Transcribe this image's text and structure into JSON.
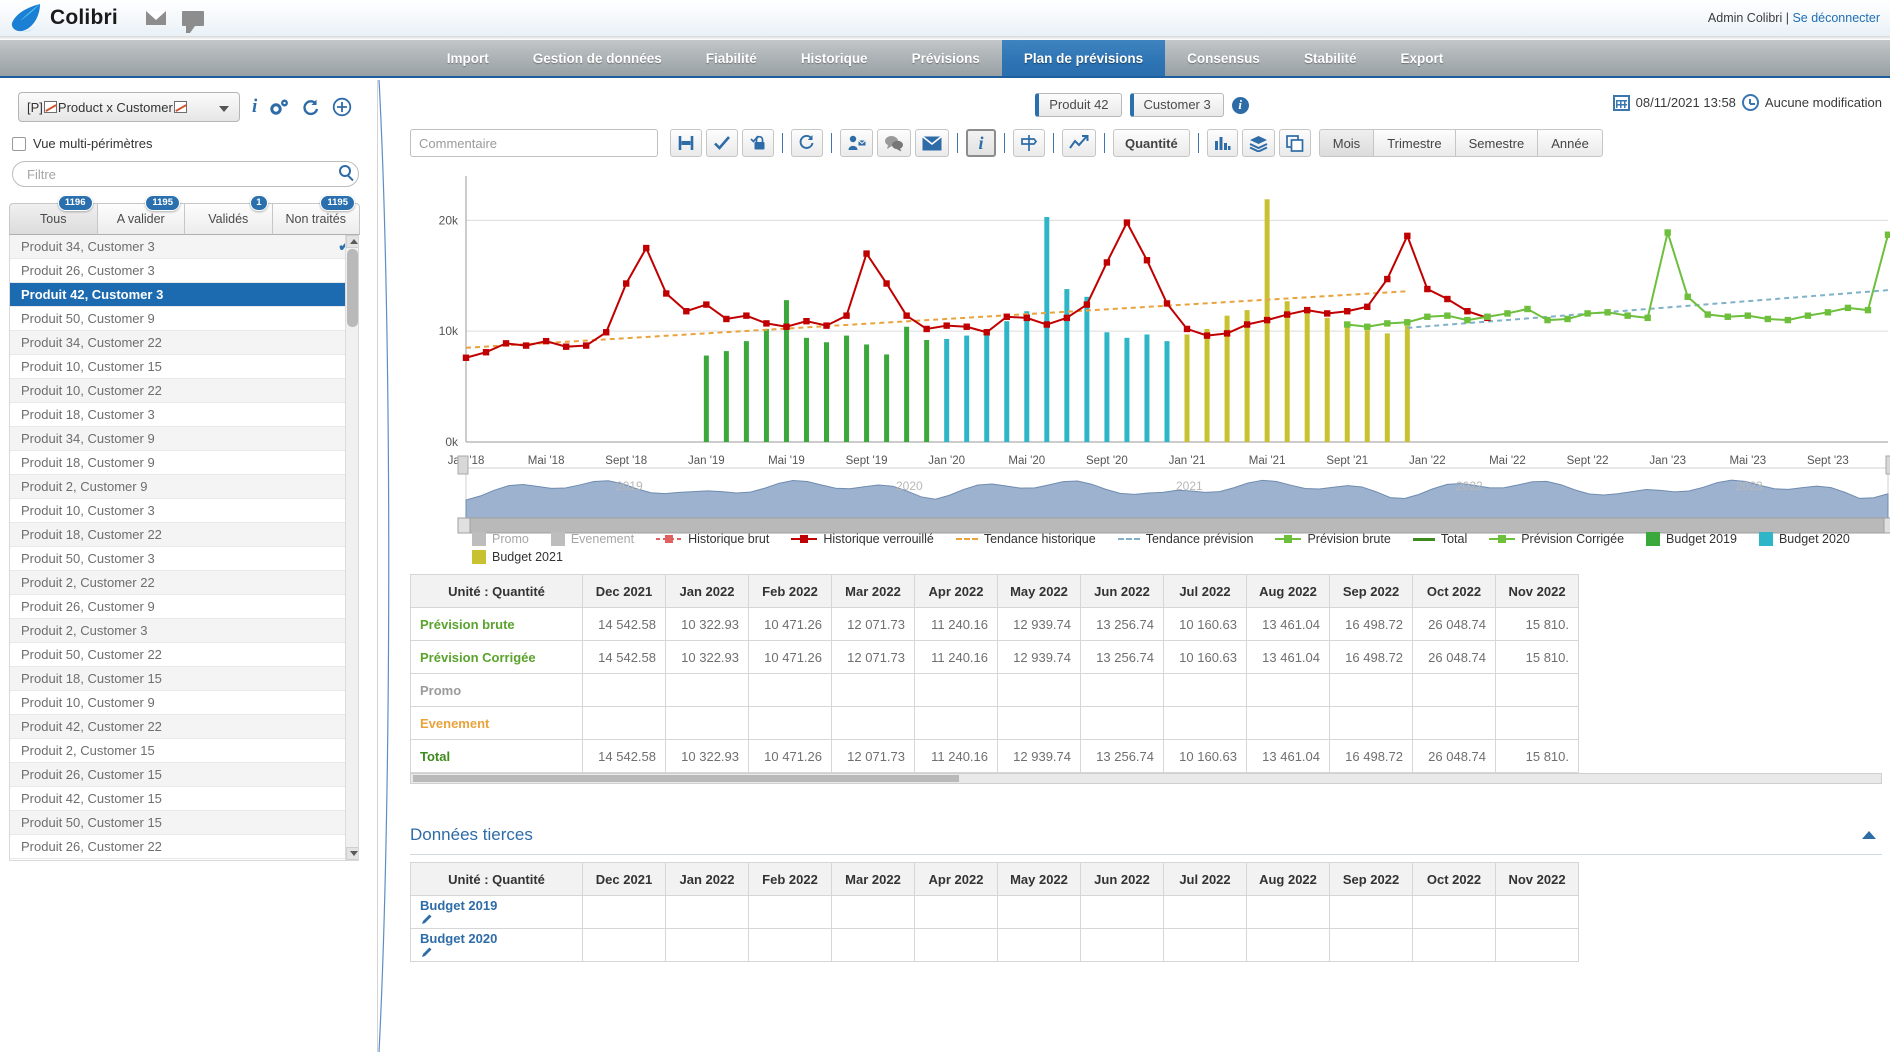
{
  "topbar": {
    "brand": "Colibri",
    "mail_icon": "envelope-icon",
    "chat_icon": "chat-bubble-icon",
    "user": "Admin Colibri | ",
    "logout": "Se déconnecter"
  },
  "nav": {
    "items": [
      {
        "label": "Import",
        "active": false
      },
      {
        "label": "Gestion de données",
        "active": false
      },
      {
        "label": "Fiabilité",
        "active": false
      },
      {
        "label": "Historique",
        "active": false
      },
      {
        "label": "Prévisions",
        "active": false
      },
      {
        "label": "Plan de prévisions",
        "active": true
      },
      {
        "label": "Consensus",
        "active": false
      },
      {
        "label": "Stabilité",
        "active": false
      },
      {
        "label": "Export",
        "active": false
      }
    ]
  },
  "sidebar": {
    "perimeter_prefix": "[P] ",
    "perimeter_label": "Product x Customer",
    "tools": [
      {
        "name": "info-icon",
        "glyph": "i"
      },
      {
        "name": "settings-gear-icon",
        "glyph": "⚙"
      },
      {
        "name": "refresh-icon",
        "glyph": "↺"
      },
      {
        "name": "add-circle-icon",
        "glyph": "⊕"
      }
    ],
    "multi_perimeter_label": "Vue multi-périmètres",
    "filter_placeholder": "Filtre",
    "tabs": [
      {
        "label": "Tous",
        "badge": "1196",
        "active": true
      },
      {
        "label": "A valider",
        "badge": "1195",
        "active": false
      },
      {
        "label": "Validés",
        "badge": "1",
        "active": false
      },
      {
        "label": "Non traités",
        "badge": "1195",
        "active": false
      }
    ],
    "items": [
      {
        "label": "Produit 34, Customer 3",
        "selected": false,
        "checked": true
      },
      {
        "label": "Produit 26, Customer 3",
        "selected": false,
        "checked": false
      },
      {
        "label": "Produit 42, Customer 3",
        "selected": true,
        "checked": false
      },
      {
        "label": "Produit 50, Customer 9",
        "selected": false,
        "checked": false
      },
      {
        "label": "Produit 34, Customer 22",
        "selected": false,
        "checked": false
      },
      {
        "label": "Produit 10, Customer 15",
        "selected": false,
        "checked": false
      },
      {
        "label": "Produit 10, Customer 22",
        "selected": false,
        "checked": false
      },
      {
        "label": "Produit 18, Customer 3",
        "selected": false,
        "checked": false
      },
      {
        "label": "Produit 34, Customer 9",
        "selected": false,
        "checked": false
      },
      {
        "label": "Produit 18, Customer 9",
        "selected": false,
        "checked": false
      },
      {
        "label": "Produit 2, Customer 9",
        "selected": false,
        "checked": false
      },
      {
        "label": "Produit 10, Customer 3",
        "selected": false,
        "checked": false
      },
      {
        "label": "Produit 18, Customer 22",
        "selected": false,
        "checked": false
      },
      {
        "label": "Produit 50, Customer 3",
        "selected": false,
        "checked": false
      },
      {
        "label": "Produit 2, Customer 22",
        "selected": false,
        "checked": false
      },
      {
        "label": "Produit 26, Customer 9",
        "selected": false,
        "checked": false
      },
      {
        "label": "Produit 2, Customer 3",
        "selected": false,
        "checked": false
      },
      {
        "label": "Produit 50, Customer 22",
        "selected": false,
        "checked": false
      },
      {
        "label": "Produit 18, Customer 15",
        "selected": false,
        "checked": false
      },
      {
        "label": "Produit 10, Customer 9",
        "selected": false,
        "checked": false
      },
      {
        "label": "Produit 42, Customer 22",
        "selected": false,
        "checked": false
      },
      {
        "label": "Produit 2, Customer 15",
        "selected": false,
        "checked": false
      },
      {
        "label": "Produit 26, Customer 15",
        "selected": false,
        "checked": false
      },
      {
        "label": "Produit 42, Customer 15",
        "selected": false,
        "checked": false
      },
      {
        "label": "Produit 50, Customer 15",
        "selected": false,
        "checked": false
      },
      {
        "label": "Produit 26, Customer 22",
        "selected": false,
        "checked": false
      }
    ]
  },
  "header": {
    "chips": [
      "Produit 42",
      "Customer 3"
    ],
    "info_icon": "info-circle-icon",
    "calendar_icon": "calendar-icon",
    "datetime": "08/11/2021 13:58",
    "clock_icon": "clock-icon",
    "modification_status": "Aucune modification"
  },
  "toolbar": {
    "comment_placeholder": "Commentaire",
    "buttons": [
      {
        "name": "save-button",
        "glyph": "H",
        "selected": false
      },
      {
        "name": "validate-check-button",
        "glyph": "✔",
        "selected": false
      },
      {
        "name": "lock-validate-button",
        "glyph": "🔒",
        "selected": false
      },
      {
        "name": "refresh-recalc-button",
        "glyph": "↻",
        "selected": false
      },
      {
        "name": "assign-user-button",
        "glyph": "👤",
        "selected": false
      },
      {
        "name": "comments-button",
        "glyph": "💬",
        "selected": false
      },
      {
        "name": "email-button",
        "glyph": "✉",
        "selected": false
      },
      {
        "name": "info-button",
        "glyph": "i",
        "selected": true
      },
      {
        "name": "signpost-button",
        "glyph": "⌯",
        "selected": false
      },
      {
        "name": "trend-button",
        "glyph": "📈",
        "selected": false
      }
    ],
    "unit_label": "Quantité",
    "view_buttons": [
      {
        "name": "bar-chart-button",
        "glyph": "▮"
      },
      {
        "name": "layers-button",
        "glyph": "≋"
      },
      {
        "name": "copy-button",
        "glyph": "❐"
      }
    ],
    "granularity": [
      {
        "label": "Mois",
        "active": true
      },
      {
        "label": "Trimestre",
        "active": false
      },
      {
        "label": "Semestre",
        "active": false
      },
      {
        "label": "Année",
        "active": false
      }
    ]
  },
  "chart_data": {
    "type": "line",
    "title": "",
    "xlabel": "",
    "ylabel": "",
    "ylim": [
      0,
      24000
    ],
    "yticks": [
      0,
      10000,
      20000
    ],
    "ytick_labels": [
      "0k",
      "10k",
      "20k"
    ],
    "grid": true,
    "legend_position": "bottom",
    "xtick_labels": [
      "Jan '18",
      "Mai '18",
      "Sept '18",
      "Jan '19",
      "Mai '19",
      "Sept '19",
      "Jan '20",
      "Mai '20",
      "Sept '20",
      "Jan '21",
      "Mai '21",
      "Sept '21",
      "Jan '22",
      "Mai '22",
      "Sept '22",
      "Jan '23",
      "Mai '23",
      "Sept '23"
    ],
    "legend": [
      {
        "label": "Promo",
        "color": "#bdbdbd",
        "style": "box"
      },
      {
        "label": "Evenement",
        "color": "#bdbdbd",
        "style": "box"
      },
      {
        "label": "Historique brut",
        "color": "#e06060",
        "style": "dashline-marker"
      },
      {
        "label": "Historique verrouillé",
        "color": "#c00000",
        "style": "line-marker"
      },
      {
        "label": "Tendance historique",
        "color": "#e8a33d",
        "style": "dotted"
      },
      {
        "label": "Tendance prévision",
        "color": "#7fb2c9",
        "style": "dotted"
      },
      {
        "label": "Prévision brute",
        "color": "#6dbf3c",
        "style": "line-marker"
      },
      {
        "label": "Total",
        "color": "#3f8a1d",
        "style": "line"
      },
      {
        "label": "Prévision Corrigée",
        "color": "#6dbf3c",
        "style": "line-marker"
      },
      {
        "label": "Budget 2019",
        "color": "#3aa83a",
        "style": "box"
      },
      {
        "label": "Budget 2020",
        "color": "#2eb6c8",
        "style": "box"
      },
      {
        "label": "Budget 2021",
        "color": "#c8c232",
        "style": "box"
      }
    ],
    "series": [
      {
        "name": "Historique verrouillé",
        "color": "#c00000",
        "values": [
          7600,
          8100,
          8900,
          8700,
          9100,
          8600,
          8700,
          9900,
          14300,
          17500,
          13400,
          11800,
          12400,
          11100,
          11400,
          10700,
          10400,
          10900,
          10500,
          11400,
          17000,
          14300,
          11400,
          10200,
          10500,
          10400,
          9900,
          11300,
          11200,
          10600,
          11200,
          12400,
          16200,
          19800,
          16400,
          12500,
          10200,
          9600,
          9800,
          10600,
          11000,
          11500,
          11900,
          11600,
          11800,
          12200,
          14700,
          18600,
          13800,
          12900,
          11800,
          11200
        ]
      },
      {
        "name": "Prévision brute",
        "color": "#6dbf3c",
        "values": [
          10600,
          10400,
          10700,
          10800,
          11300,
          11400,
          11000,
          11300,
          11600,
          12000,
          11000,
          11100,
          11600,
          11700,
          11400,
          11200,
          18900,
          13100,
          11500,
          11300,
          11400,
          11100,
          11000,
          11400,
          11700,
          12100,
          11900,
          18700
        ]
      },
      {
        "name": "Budget 2019",
        "color": "#3aa83a",
        "type": "bar",
        "values": [
          7800,
          8200,
          9100,
          10200,
          12800,
          9400,
          9000,
          9600,
          8800,
          7900,
          10400,
          9200
        ]
      },
      {
        "name": "Budget 2020",
        "color": "#2eb6c8",
        "type": "bar",
        "values": [
          9300,
          9600,
          10200,
          10900,
          11800,
          20300,
          13800,
          13100,
          9900,
          9400,
          9700,
          9100
        ]
      },
      {
        "name": "Budget 2021",
        "color": "#c8c232",
        "type": "bar",
        "values": [
          9700,
          10200,
          11400,
          11900,
          21900,
          12700,
          12000,
          11200,
          10600,
          10100,
          9800,
          10500
        ]
      },
      {
        "name": "Tendance historique",
        "color": "#e8a33d",
        "type": "trend",
        "values": [
          8500,
          13600
        ]
      },
      {
        "name": "Tendance prévision",
        "color": "#7fb2c9",
        "type": "trend",
        "values": [
          10300,
          13700
        ]
      }
    ],
    "navigator": {
      "year_labels": [
        "2019",
        "2020",
        "2021",
        "2022",
        "2023"
      ],
      "color": "#8fa8c4"
    }
  },
  "main_table": {
    "unit_header": "Unité : Quantité",
    "columns": [
      "Dec 2021",
      "Jan 2022",
      "Feb 2022",
      "Mar 2022",
      "Apr 2022",
      "May 2022",
      "Jun 2022",
      "Jul 2022",
      "Aug 2022",
      "Sep 2022",
      "Oct 2022",
      "Nov 2022"
    ],
    "rows": [
      {
        "label": "Prévision brute",
        "color_class": "c-green",
        "values": [
          "14 542.58",
          "10 322.93",
          "10 471.26",
          "12 071.73",
          "11 240.16",
          "12 939.74",
          "13 256.74",
          "10 160.63",
          "13 461.04",
          "16 498.72",
          "26 048.74",
          "15 810."
        ]
      },
      {
        "label": "Prévision Corrigée",
        "color_class": "c-green",
        "values": [
          "14 542.58",
          "10 322.93",
          "10 471.26",
          "12 071.73",
          "11 240.16",
          "12 939.74",
          "13 256.74",
          "10 160.63",
          "13 461.04",
          "16 498.72",
          "26 048.74",
          "15 810."
        ]
      },
      {
        "label": "Promo",
        "color_class": "c-gray",
        "values": [
          "",
          "",
          "",
          "",
          "",
          "",
          "",
          "",
          "",
          "",
          "",
          ""
        ]
      },
      {
        "label": "Evenement",
        "color_class": "c-orange",
        "values": [
          "",
          "",
          "",
          "",
          "",
          "",
          "",
          "",
          "",
          "",
          "",
          ""
        ]
      },
      {
        "label": "Total",
        "color_class": "c-olive",
        "values": [
          "14 542.58",
          "10 322.93",
          "10 471.26",
          "12 071.73",
          "11 240.16",
          "12 939.74",
          "13 256.74",
          "10 160.63",
          "13 461.04",
          "16 498.72",
          "26 048.74",
          "15 810."
        ]
      }
    ]
  },
  "third_party": {
    "title": "Données tierces",
    "collapse_icon": "chevron-up-icon",
    "unit_header": "Unité : Quantité",
    "columns": [
      "Dec 2021",
      "Jan 2022",
      "Feb 2022",
      "Mar 2022",
      "Apr 2022",
      "May 2022",
      "Jun 2022",
      "Jul 2022",
      "Aug 2022",
      "Sep 2022",
      "Oct 2022",
      "Nov 2022"
    ],
    "rows": [
      {
        "label": "Budget 2019",
        "edit_icon": "pencil-icon",
        "values": [
          "",
          "",
          "",
          "",
          "",
          "",
          "",
          "",
          "",
          "",
          "",
          ""
        ]
      },
      {
        "label": "Budget 2020",
        "edit_icon": "pencil-icon",
        "values": [
          "",
          "",
          "",
          "",
          "",
          "",
          "",
          "",
          "",
          "",
          "",
          ""
        ]
      }
    ]
  }
}
